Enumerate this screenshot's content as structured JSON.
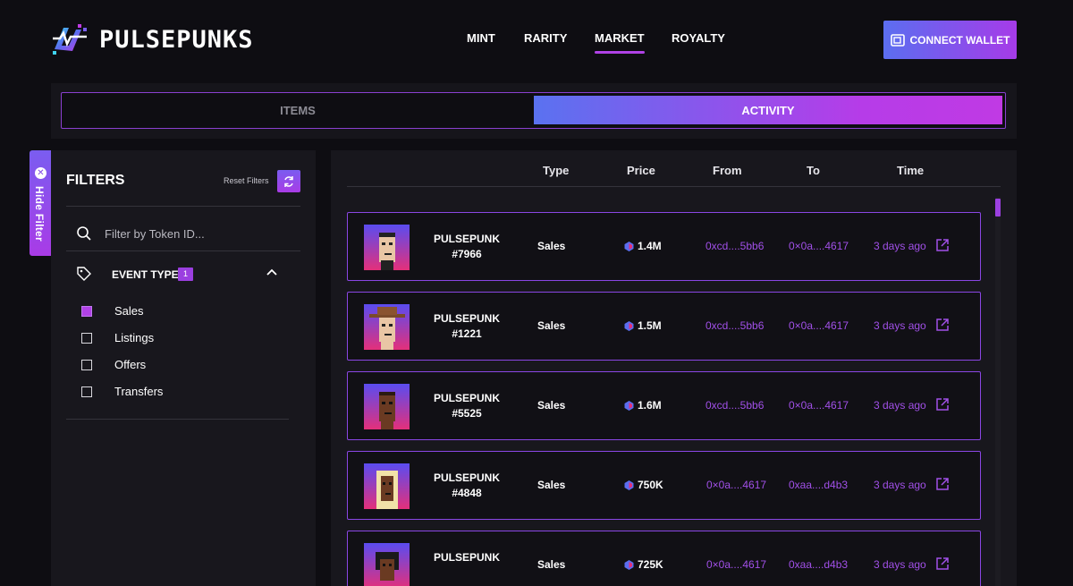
{
  "brand": {
    "name": "PULSEPUNKS"
  },
  "nav": {
    "items": [
      {
        "label": "MINT"
      },
      {
        "label": "RARITY"
      },
      {
        "label": "MARKET"
      },
      {
        "label": "ROYALTY"
      }
    ],
    "active": "MARKET",
    "connect_label": "CONNECT WALLET"
  },
  "tabs": {
    "items_label": "ITEMS",
    "activity_label": "ACTIVITY",
    "active": "ACTIVITY"
  },
  "filters": {
    "hide_label": "Hide Filter",
    "title": "FILTERS",
    "reset_label": "Reset Filters",
    "search_placeholder": "Filter by Token ID...",
    "event_type_label": "EVENT TYPE",
    "event_type_count": "1",
    "options": [
      {
        "label": "Sales",
        "checked": true
      },
      {
        "label": "Listings",
        "checked": false
      },
      {
        "label": "Offers",
        "checked": false
      },
      {
        "label": "Transfers",
        "checked": false
      }
    ]
  },
  "table": {
    "headers": {
      "type": "Type",
      "price": "Price",
      "from": "From",
      "to": "To",
      "time": "Time"
    },
    "rows": [
      {
        "name_line1": "PULSEPUNK",
        "name_line2": "#7966",
        "type": "Sales",
        "price": "1.4M",
        "from": "0xcd....5bb6",
        "to": "0×0a....4617",
        "time": "3 days ago"
      },
      {
        "name_line1": "PULSEPUNK",
        "name_line2": "#1221",
        "type": "Sales",
        "price": "1.5M",
        "from": "0xcd....5bb6",
        "to": "0×0a....4617",
        "time": "3 days ago"
      },
      {
        "name_line1": "PULSEPUNK",
        "name_line2": "#5525",
        "type": "Sales",
        "price": "1.6M",
        "from": "0xcd....5bb6",
        "to": "0×0a....4617",
        "time": "3 days ago"
      },
      {
        "name_line1": "PULSEPUNK",
        "name_line2": "#4848",
        "type": "Sales",
        "price": "750K",
        "from": "0×0a....4617",
        "to": "0xaa....d4b3",
        "time": "3 days ago"
      },
      {
        "name_line1": "PULSEPUNK",
        "name_line2": "",
        "type": "Sales",
        "price": "725K",
        "from": "0×0a....4617",
        "to": "0xaa....d4b3",
        "time": "3 days ago"
      }
    ]
  },
  "colors": {
    "accent": "#a150e8",
    "background": "#0e0d12",
    "panel": "#18171d"
  }
}
